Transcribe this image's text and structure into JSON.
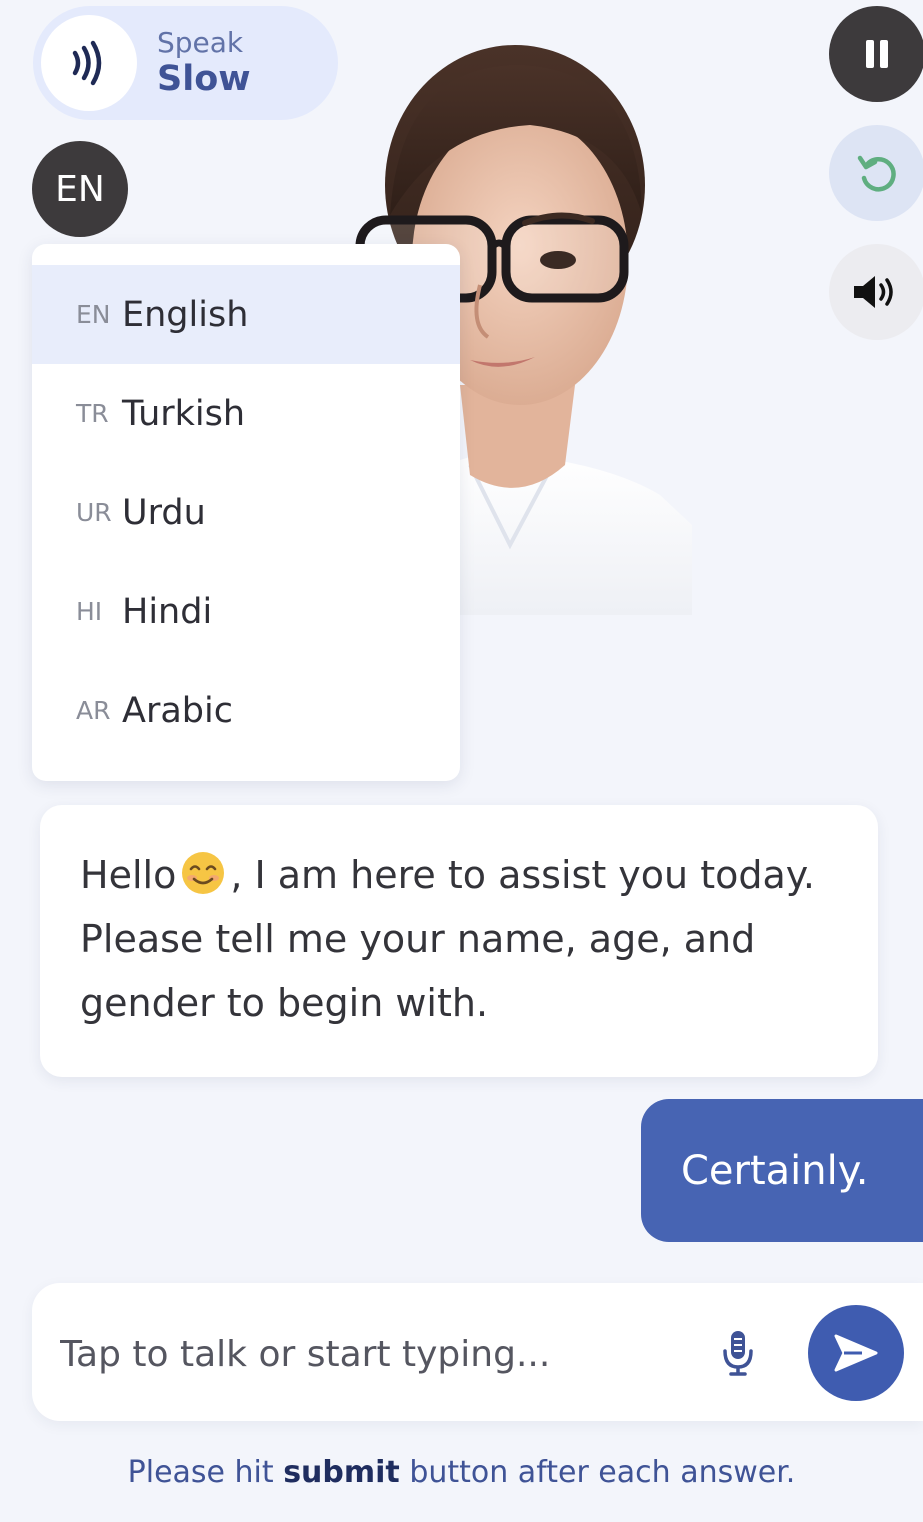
{
  "speak": {
    "label_small": "Speak",
    "label_big": "Slow"
  },
  "language": {
    "current": "EN",
    "options": [
      {
        "code": "EN",
        "name": "English",
        "selected": true
      },
      {
        "code": "TR",
        "name": "Turkish",
        "selected": false
      },
      {
        "code": "UR",
        "name": "Urdu",
        "selected": false
      },
      {
        "code": "HI",
        "name": "Hindi",
        "selected": false
      },
      {
        "code": "AR",
        "name": "Arabic",
        "selected": false
      }
    ]
  },
  "controls": {
    "pause_icon": "pause-icon",
    "reload_icon": "reload-icon",
    "volume_icon": "volume-icon"
  },
  "messages": {
    "bot": {
      "greeting": "Hello",
      "emoji": "smiling-face",
      "text": ", I am here to assist you today. Please tell me your name, age, and gender to begin with."
    },
    "user": {
      "text": "Certainly."
    }
  },
  "input": {
    "placeholder": "Tap to talk or start typing...",
    "value": ""
  },
  "hint": {
    "before": "Please hit ",
    "bold": "submit",
    "after": " button after each answer."
  },
  "colors": {
    "background": "#f3f5fb",
    "accent": "#4764b3",
    "dark_button": "#3d3a3c",
    "pill": "#e4eafc",
    "selected_row": "#e8edfb",
    "reload_green": "#5fae80"
  }
}
